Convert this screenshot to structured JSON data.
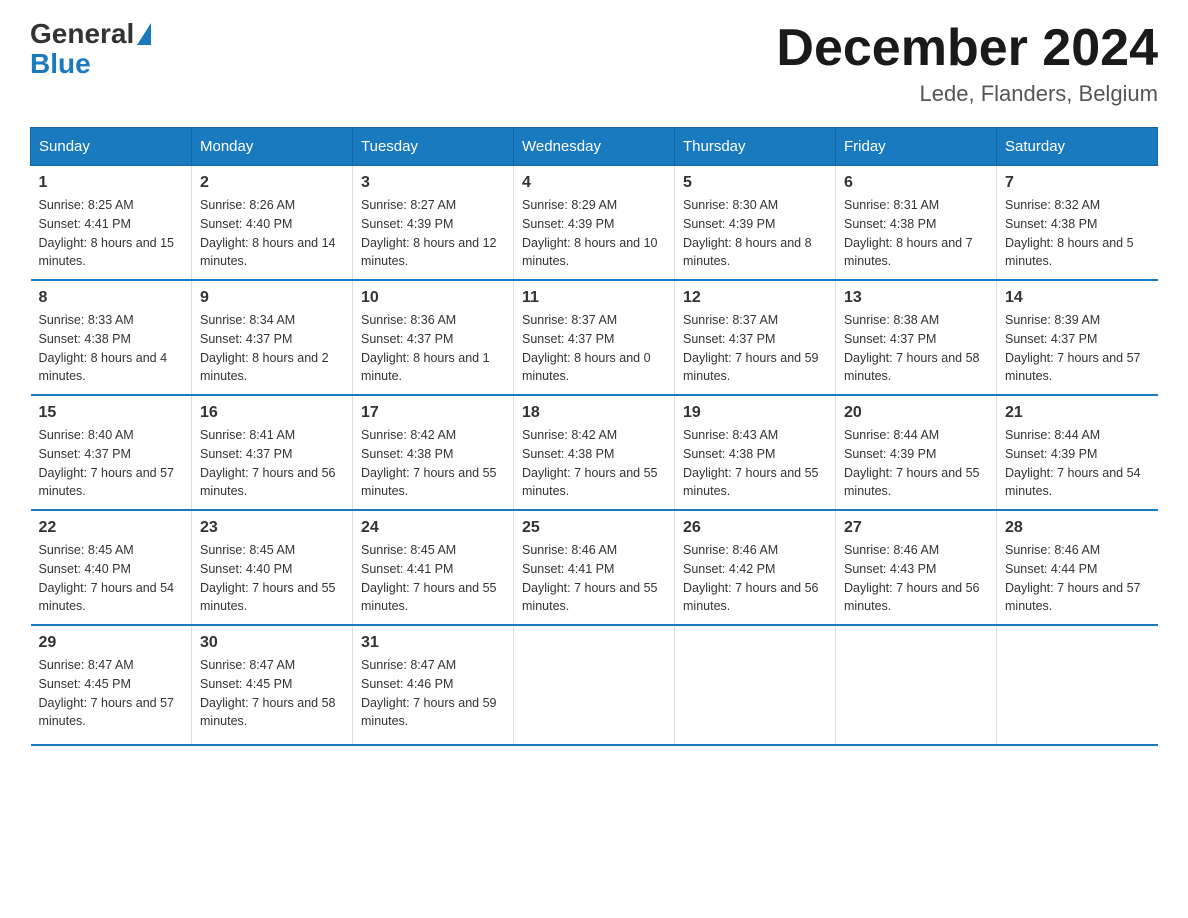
{
  "header": {
    "logo_general": "General",
    "logo_blue": "Blue",
    "title": "December 2024",
    "subtitle": "Lede, Flanders, Belgium"
  },
  "days_of_week": [
    "Sunday",
    "Monday",
    "Tuesday",
    "Wednesday",
    "Thursday",
    "Friday",
    "Saturday"
  ],
  "weeks": [
    [
      {
        "day": "1",
        "sunrise": "8:25 AM",
        "sunset": "4:41 PM",
        "daylight": "8 hours and 15 minutes."
      },
      {
        "day": "2",
        "sunrise": "8:26 AM",
        "sunset": "4:40 PM",
        "daylight": "8 hours and 14 minutes."
      },
      {
        "day": "3",
        "sunrise": "8:27 AM",
        "sunset": "4:39 PM",
        "daylight": "8 hours and 12 minutes."
      },
      {
        "day": "4",
        "sunrise": "8:29 AM",
        "sunset": "4:39 PM",
        "daylight": "8 hours and 10 minutes."
      },
      {
        "day": "5",
        "sunrise": "8:30 AM",
        "sunset": "4:39 PM",
        "daylight": "8 hours and 8 minutes."
      },
      {
        "day": "6",
        "sunrise": "8:31 AM",
        "sunset": "4:38 PM",
        "daylight": "8 hours and 7 minutes."
      },
      {
        "day": "7",
        "sunrise": "8:32 AM",
        "sunset": "4:38 PM",
        "daylight": "8 hours and 5 minutes."
      }
    ],
    [
      {
        "day": "8",
        "sunrise": "8:33 AM",
        "sunset": "4:38 PM",
        "daylight": "8 hours and 4 minutes."
      },
      {
        "day": "9",
        "sunrise": "8:34 AM",
        "sunset": "4:37 PM",
        "daylight": "8 hours and 2 minutes."
      },
      {
        "day": "10",
        "sunrise": "8:36 AM",
        "sunset": "4:37 PM",
        "daylight": "8 hours and 1 minute."
      },
      {
        "day": "11",
        "sunrise": "8:37 AM",
        "sunset": "4:37 PM",
        "daylight": "8 hours and 0 minutes."
      },
      {
        "day": "12",
        "sunrise": "8:37 AM",
        "sunset": "4:37 PM",
        "daylight": "7 hours and 59 minutes."
      },
      {
        "day": "13",
        "sunrise": "8:38 AM",
        "sunset": "4:37 PM",
        "daylight": "7 hours and 58 minutes."
      },
      {
        "day": "14",
        "sunrise": "8:39 AM",
        "sunset": "4:37 PM",
        "daylight": "7 hours and 57 minutes."
      }
    ],
    [
      {
        "day": "15",
        "sunrise": "8:40 AM",
        "sunset": "4:37 PM",
        "daylight": "7 hours and 57 minutes."
      },
      {
        "day": "16",
        "sunrise": "8:41 AM",
        "sunset": "4:37 PM",
        "daylight": "7 hours and 56 minutes."
      },
      {
        "day": "17",
        "sunrise": "8:42 AM",
        "sunset": "4:38 PM",
        "daylight": "7 hours and 55 minutes."
      },
      {
        "day": "18",
        "sunrise": "8:42 AM",
        "sunset": "4:38 PM",
        "daylight": "7 hours and 55 minutes."
      },
      {
        "day": "19",
        "sunrise": "8:43 AM",
        "sunset": "4:38 PM",
        "daylight": "7 hours and 55 minutes."
      },
      {
        "day": "20",
        "sunrise": "8:44 AM",
        "sunset": "4:39 PM",
        "daylight": "7 hours and 55 minutes."
      },
      {
        "day": "21",
        "sunrise": "8:44 AM",
        "sunset": "4:39 PM",
        "daylight": "7 hours and 54 minutes."
      }
    ],
    [
      {
        "day": "22",
        "sunrise": "8:45 AM",
        "sunset": "4:40 PM",
        "daylight": "7 hours and 54 minutes."
      },
      {
        "day": "23",
        "sunrise": "8:45 AM",
        "sunset": "4:40 PM",
        "daylight": "7 hours and 55 minutes."
      },
      {
        "day": "24",
        "sunrise": "8:45 AM",
        "sunset": "4:41 PM",
        "daylight": "7 hours and 55 minutes."
      },
      {
        "day": "25",
        "sunrise": "8:46 AM",
        "sunset": "4:41 PM",
        "daylight": "7 hours and 55 minutes."
      },
      {
        "day": "26",
        "sunrise": "8:46 AM",
        "sunset": "4:42 PM",
        "daylight": "7 hours and 56 minutes."
      },
      {
        "day": "27",
        "sunrise": "8:46 AM",
        "sunset": "4:43 PM",
        "daylight": "7 hours and 56 minutes."
      },
      {
        "day": "28",
        "sunrise": "8:46 AM",
        "sunset": "4:44 PM",
        "daylight": "7 hours and 57 minutes."
      }
    ],
    [
      {
        "day": "29",
        "sunrise": "8:47 AM",
        "sunset": "4:45 PM",
        "daylight": "7 hours and 57 minutes."
      },
      {
        "day": "30",
        "sunrise": "8:47 AM",
        "sunset": "4:45 PM",
        "daylight": "7 hours and 58 minutes."
      },
      {
        "day": "31",
        "sunrise": "8:47 AM",
        "sunset": "4:46 PM",
        "daylight": "7 hours and 59 minutes."
      },
      {
        "day": "",
        "sunrise": "",
        "sunset": "",
        "daylight": ""
      },
      {
        "day": "",
        "sunrise": "",
        "sunset": "",
        "daylight": ""
      },
      {
        "day": "",
        "sunrise": "",
        "sunset": "",
        "daylight": ""
      },
      {
        "day": "",
        "sunrise": "",
        "sunset": "",
        "daylight": ""
      }
    ]
  ],
  "labels": {
    "sunrise": "Sunrise:",
    "sunset": "Sunset:",
    "daylight": "Daylight:"
  }
}
